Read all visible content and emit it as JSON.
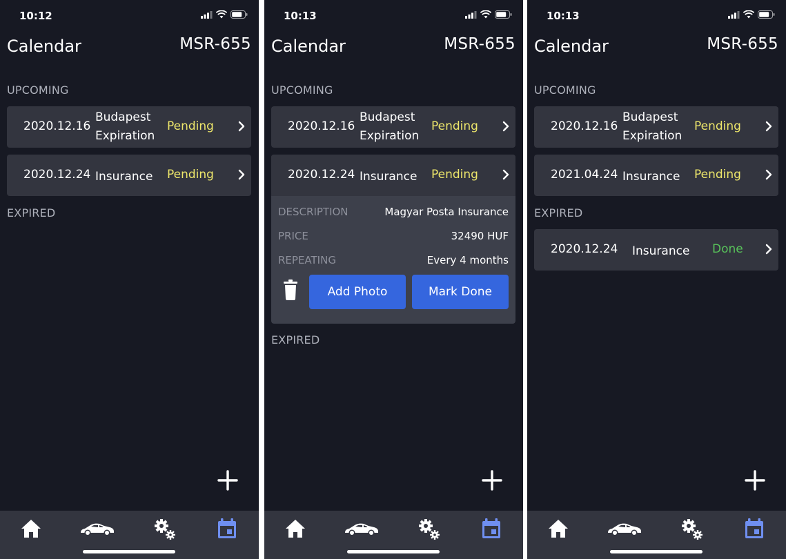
{
  "screens": [
    {
      "time": "10:12",
      "title": "Calendar",
      "plate": "MSR-655",
      "upcoming_label": "UPCOMING",
      "expired_label": "EXPIRED",
      "upcoming": [
        {
          "date": "2020.12.16",
          "title_line1": "Budapest",
          "title_line2": "Expiration",
          "status": "Pending"
        },
        {
          "date": "2020.12.24",
          "title": "Insurance",
          "status": "Pending"
        }
      ]
    },
    {
      "time": "10:13",
      "title": "Calendar",
      "plate": "MSR-655",
      "upcoming_label": "UPCOMING",
      "expired_label": "EXPIRED",
      "upcoming": [
        {
          "date": "2020.12.16",
          "title_line1": "Budapest",
          "title_line2": "Expiration",
          "status": "Pending"
        },
        {
          "date": "2020.12.24",
          "title": "Insurance",
          "status": "Pending"
        }
      ],
      "details": {
        "description_label": "DESCRIPTION",
        "description_value": "Magyar Posta Insurance",
        "price_label": "PRICE",
        "price_value": "32490 HUF",
        "repeating_label": "REPEATING",
        "repeating_value": "Every 4 months",
        "add_photo_label": "Add Photo",
        "mark_done_label": "Mark Done"
      }
    },
    {
      "time": "10:13",
      "title": "Calendar",
      "plate": "MSR-655",
      "upcoming_label": "UPCOMING",
      "expired_label": "EXPIRED",
      "upcoming": [
        {
          "date": "2020.12.16",
          "title_line1": "Budapest",
          "title_line2": "Expiration",
          "status": "Pending"
        },
        {
          "date": "2021.04.24",
          "title": "Insurance",
          "status": "Pending"
        }
      ],
      "expired": [
        {
          "date": "2020.12.24",
          "title": "Insurance",
          "status": "Done"
        }
      ]
    }
  ],
  "colors": {
    "background": "#171923",
    "card": "#33353f",
    "expanded_panel": "#3d404b",
    "pending": "#ede66b",
    "done": "#58c25a",
    "button": "#3566de",
    "active_tab": "#6f8ff0",
    "inactive_tab": "#ffffff",
    "section_label": "#aeb1bb"
  },
  "icons": {
    "tabs": [
      "home-icon",
      "car-icon",
      "settings-gears-icon",
      "calendar-icon"
    ],
    "active_tab": "calendar-icon",
    "add": "plus-icon",
    "delete": "trash-icon",
    "row_action": "chevron-right-icon"
  }
}
